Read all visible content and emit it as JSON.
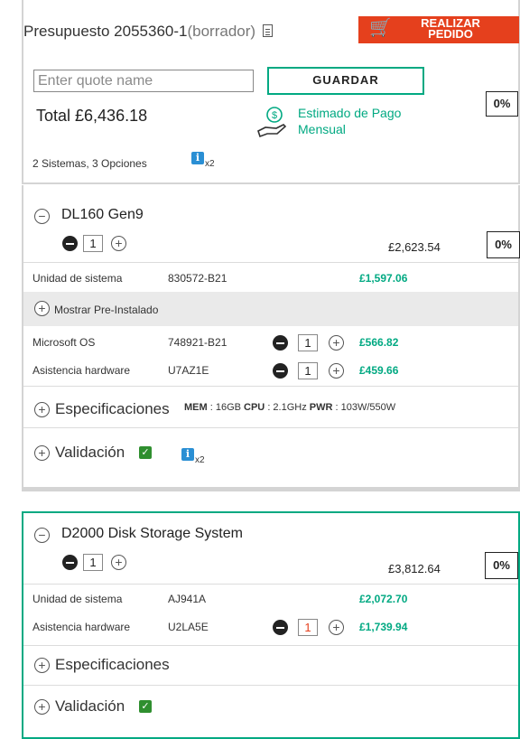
{
  "quote": {
    "title": "Presupuesto 2055360-1",
    "status": "(borrador)",
    "order_button": "REALIZAR PEDIDO",
    "name_placeholder": "Enter quote name",
    "save_button": "GUARDAR",
    "discount": "0%",
    "total": "Total £6,436.18",
    "payment_label_1": "Estimado de Pago",
    "payment_label_2": "Mensual",
    "summary": "2 Sistemas, 3 Opciones",
    "info_count": "x2"
  },
  "systems": [
    {
      "name": "DL160 Gen9",
      "qty": "1",
      "price": "£2,623.54",
      "discount": "0%",
      "base": {
        "label": "Unidad de sistema",
        "sku": "830572-B21",
        "price": "£1,597.06"
      },
      "preinstalled_label": "Mostrar Pre-Instalado",
      "options": [
        {
          "label": "Microsoft OS",
          "sku": "748921-B21",
          "qty": "1",
          "price": "£566.82"
        },
        {
          "label": "Asistencia hardware",
          "sku": "U7AZ1E",
          "qty": "1",
          "price": "£459.66"
        }
      ],
      "specs_label": "Especificaciones",
      "specs": {
        "mem_label": "MEM",
        "mem_value": " : 16GB ",
        "cpu_label": "CPU",
        "cpu_value": " : 2.1GHz ",
        "pwr_label": "PWR",
        "pwr_value": " : 103W/550W"
      },
      "validation_label": "Validación",
      "info_count": "x2"
    },
    {
      "name": "D2000 Disk Storage System",
      "qty": "1",
      "price": "£3,812.64",
      "discount": "0%",
      "base": {
        "label": "Unidad de sistema",
        "sku": "AJ941A",
        "price": "£2,072.70"
      },
      "options": [
        {
          "label": "Asistencia hardware",
          "sku": "U2LA5E",
          "qty": "1",
          "price": "£1,739.94"
        }
      ],
      "specs_label": "Especificaciones",
      "validation_label": "Validación"
    }
  ],
  "icons": {
    "cart": "cart-plus-icon",
    "document": "document-icon",
    "payment": "hand-dollar-icon",
    "info": "info-icon",
    "check": "check-icon"
  },
  "colors": {
    "brand_green": "#01a982",
    "order_red": "#e5401d",
    "info_blue": "#2a8fd4"
  }
}
